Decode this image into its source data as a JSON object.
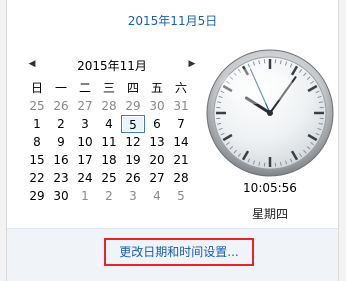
{
  "header": {
    "long_date": "2015年11月5日"
  },
  "calendar": {
    "month_title": "2015年11月",
    "prev_icon": "triangle-left-icon",
    "next_icon": "triangle-right-icon",
    "weekdays": [
      "日",
      "一",
      "二",
      "三",
      "四",
      "五",
      "六"
    ],
    "weeks": [
      [
        {
          "d": "25",
          "other": true
        },
        {
          "d": "26",
          "other": true
        },
        {
          "d": "27",
          "other": true
        },
        {
          "d": "28",
          "other": true
        },
        {
          "d": "29",
          "other": true
        },
        {
          "d": "30",
          "other": true
        },
        {
          "d": "31",
          "other": true
        }
      ],
      [
        {
          "d": "1"
        },
        {
          "d": "2"
        },
        {
          "d": "3"
        },
        {
          "d": "4"
        },
        {
          "d": "5",
          "today": true
        },
        {
          "d": "6"
        },
        {
          "d": "7"
        }
      ],
      [
        {
          "d": "8"
        },
        {
          "d": "9"
        },
        {
          "d": "10"
        },
        {
          "d": "11"
        },
        {
          "d": "12"
        },
        {
          "d": "13"
        },
        {
          "d": "14"
        }
      ],
      [
        {
          "d": "15"
        },
        {
          "d": "16"
        },
        {
          "d": "17"
        },
        {
          "d": "18"
        },
        {
          "d": "19"
        },
        {
          "d": "20"
        },
        {
          "d": "21"
        }
      ],
      [
        {
          "d": "22"
        },
        {
          "d": "23"
        },
        {
          "d": "24"
        },
        {
          "d": "25"
        },
        {
          "d": "26"
        },
        {
          "d": "27"
        },
        {
          "d": "28"
        }
      ],
      [
        {
          "d": "29"
        },
        {
          "d": "30"
        },
        {
          "d": "1",
          "other": true
        },
        {
          "d": "2",
          "other": true
        },
        {
          "d": "3",
          "other": true
        },
        {
          "d": "4",
          "other": true
        },
        {
          "d": "5",
          "other": true
        }
      ]
    ]
  },
  "clock": {
    "time": "10:05:56",
    "weekday": "星期四",
    "hour": 10,
    "minute": 5,
    "second": 56
  },
  "footer": {
    "link_label": "更改日期和时间设置..."
  },
  "colors": {
    "link": "#1a5bb5",
    "highlight_border": "#e8232b",
    "header_date": "#1a60b8"
  }
}
